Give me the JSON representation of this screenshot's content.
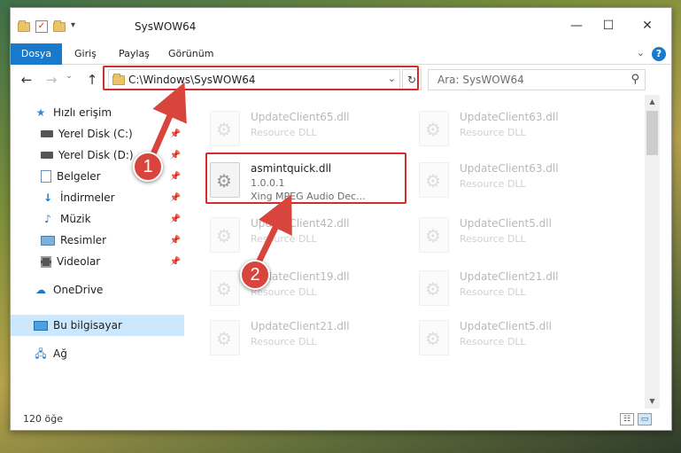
{
  "window": {
    "title": "SysWOW64",
    "controls": {
      "minimize": "—",
      "maximize": "☐",
      "close": "✕"
    }
  },
  "ribbon": {
    "tabs": [
      "Dosya",
      "Giriş",
      "Paylaş",
      "Görünüm"
    ],
    "help": "?"
  },
  "navigation": {
    "address": "C:\\Windows\\SysWOW64",
    "search_placeholder": "Ara: SysWOW64"
  },
  "sidebar": {
    "items": [
      {
        "label": "Hızlı erişim",
        "icon": "star-icon"
      },
      {
        "label": "Yerel Disk (C:)",
        "icon": "drive-icon",
        "pinned": true
      },
      {
        "label": "Yerel Disk (D:)",
        "icon": "drive-icon",
        "pinned": true
      },
      {
        "label": "Belgeler",
        "icon": "documents-icon",
        "pinned": true
      },
      {
        "label": "İndirmeler",
        "icon": "download-icon",
        "pinned": true
      },
      {
        "label": "Müzik",
        "icon": "music-icon",
        "pinned": true
      },
      {
        "label": "Resimler",
        "icon": "pictures-icon",
        "pinned": true
      },
      {
        "label": "Videolar",
        "icon": "videos-icon",
        "pinned": true
      },
      {
        "label": "OneDrive",
        "icon": "cloud-icon"
      },
      {
        "label": "Bu bilgisayar",
        "icon": "computer-icon",
        "selected": true
      },
      {
        "label": "Ağ",
        "icon": "network-icon"
      }
    ]
  },
  "files": [
    {
      "name": "UpdateClient65.dll",
      "type": "Resource DLL"
    },
    {
      "name": "UpdateClient63.dll",
      "type": "Resource DLL"
    },
    {
      "name": "asmintquick.dll",
      "version": "1.0.0.1",
      "description": "Xing MPEG Audio Dec...",
      "highlighted": true
    },
    {
      "name": "UpdateClient63.dll",
      "type": "Resource DLL"
    },
    {
      "name": "UpdateClient42.dll",
      "type": "Resource DLL"
    },
    {
      "name": "UpdateClient5.dll",
      "type": "Resource DLL"
    },
    {
      "name": "UpdateClient19.dll",
      "type": "Resource DLL"
    },
    {
      "name": "UpdateClient21.dll",
      "type": "Resource DLL"
    },
    {
      "name": "UpdateClient21.dll",
      "type": "Resource DLL"
    },
    {
      "name": "UpdateClient5.dll",
      "type": "Resource DLL"
    }
  ],
  "status": {
    "item_count": "120 öğe"
  },
  "annotations": {
    "marker1": "1",
    "marker2": "2"
  },
  "colors": {
    "accent": "#1979ca",
    "highlight": "#d42b2b",
    "selected": "#cce8ff"
  }
}
